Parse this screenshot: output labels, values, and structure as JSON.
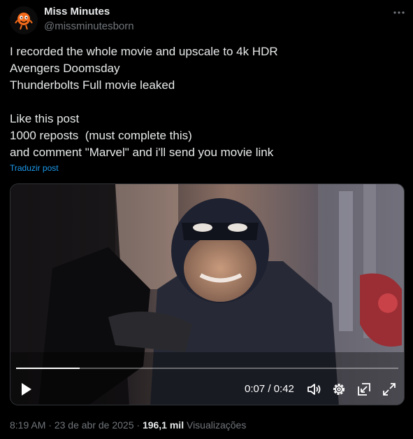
{
  "author": {
    "name": "Miss Minutes",
    "handle": "@missminutesborn"
  },
  "post": {
    "lines": [
      "I recorded the whole movie and upscale to 4k HDR",
      "Avengers Doomsday",
      "Thunderbolts Full movie leaked",
      "",
      "Like this post",
      "1000 reposts  (must complete this)",
      "and comment \"Marvel\" and i'll send you movie link"
    ],
    "translate_label": "Traduzir post"
  },
  "video": {
    "time_display": "0:07 / 0:42",
    "progress": 0.1667
  },
  "meta": {
    "time": "8:19 AM",
    "separator": "·",
    "date": "23 de abr de 2025",
    "views_count": "196,1 mil",
    "views_label": "Visualizações"
  },
  "icons": {
    "more": "more-horizontal-icon",
    "play": "play-icon",
    "volume": "volume-icon",
    "settings": "settings-gear-icon",
    "pip": "picture-in-picture-icon",
    "fullscreen": "fullscreen-icon"
  }
}
